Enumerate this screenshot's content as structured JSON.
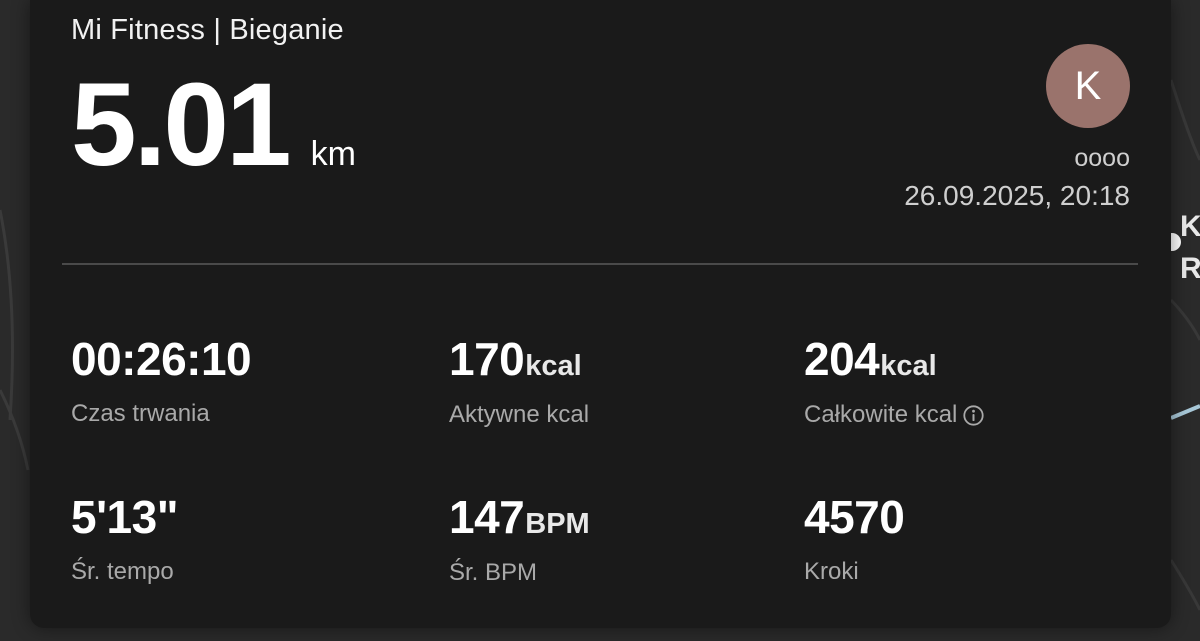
{
  "header": {
    "app_title": "Mi Fitness | Bieganie",
    "distance_value": "5.01",
    "distance_unit": "km",
    "avatar_letter": "K",
    "username": "oooo",
    "datetime": "26.09.2025, 20:18"
  },
  "stats": [
    {
      "value": "00:26:10",
      "unit": "",
      "label": "Czas trwania"
    },
    {
      "value": "170",
      "unit": "kcal",
      "label": "Aktywne kcal"
    },
    {
      "value": "204",
      "unit": "kcal",
      "label": "Całkowite kcal",
      "icon": "info-icon"
    },
    {
      "value": "5'13\"",
      "unit": "",
      "label": "Śr. tempo"
    },
    {
      "value": "147",
      "unit": "BPM",
      "label": "Śr. BPM"
    },
    {
      "value": "4570",
      "unit": "",
      "label": "Kroki"
    }
  ],
  "map_edge": {
    "line1": "K",
    "line2": "R"
  },
  "colors": {
    "card_background": "#1a1a1a",
    "avatar_background": "#9a736c",
    "route_line": "#a8c8d8"
  }
}
